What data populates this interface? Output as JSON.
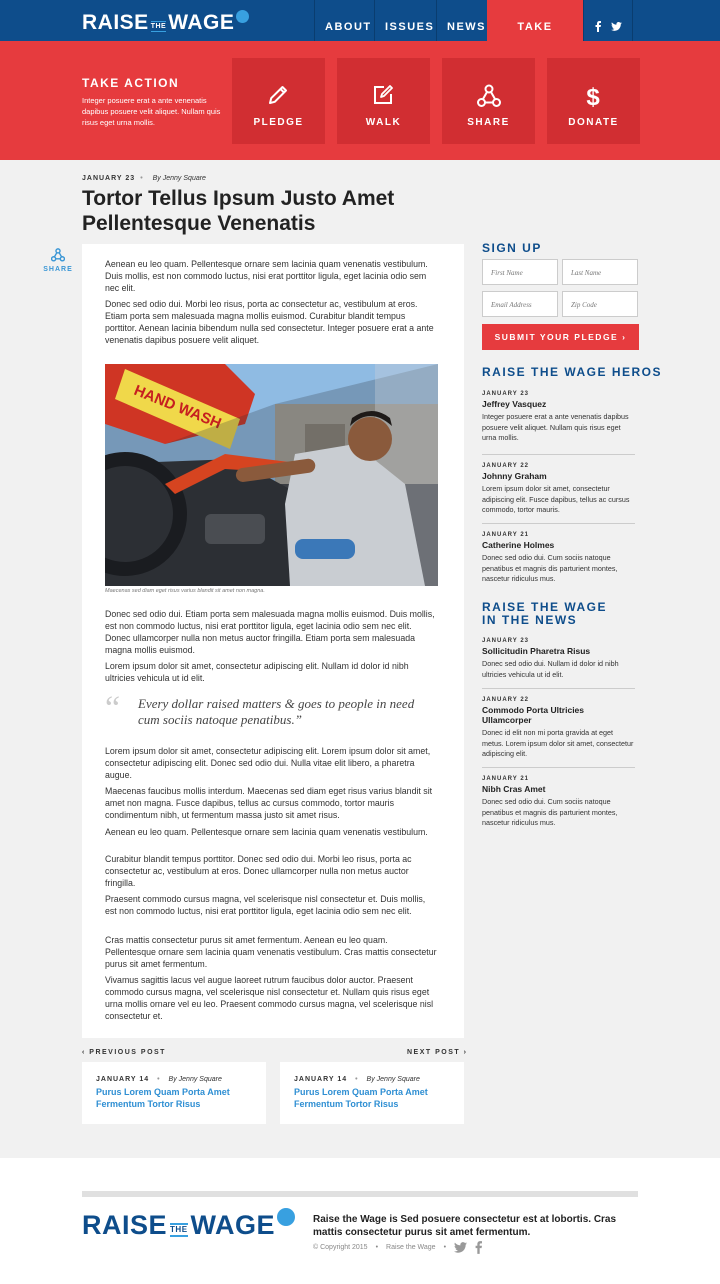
{
  "header": {
    "logo": {
      "raise": "RAISE",
      "the": "THE",
      "wage": "WAGE"
    },
    "nav": [
      "ABOUT",
      "ISSUES",
      "NEWS",
      "TAKE ACTION"
    ],
    "social": [
      "facebook-icon",
      "twitter-icon"
    ]
  },
  "action_band": {
    "title": "TAKE ACTION",
    "text": "Integer posuere erat a ante venenatis dapibus posuere velit aliquet. Nullam quis risus eget urna mollis.",
    "tiles": [
      "PLEDGE",
      "WALK",
      "SHARE",
      "DONATE"
    ]
  },
  "article": {
    "date": "JANUARY 23",
    "author": "By Jenny Square",
    "title": "Tortor Tellus Ipsum Justo Amet Pellentesque Venenatis",
    "share_label": "SHARE",
    "paragraphs_top": [
      "Aenean eu leo quam. Pellentesque ornare sem lacinia quam venenatis vestibulum. Duis mollis, est non commodo luctus, nisi erat porttitor ligula, eget lacinia odio sem nec elit.",
      "Donec sed odio dui. Morbi leo risus, porta ac consectetur ac, vestibulum at eros. Etiam porta sem malesuada magna mollis euismod. Curabitur blandit tempus porttitor. Aenean lacinia bibendum nulla sed consectetur. Integer posuere erat a ante venenatis dapibus posuere velit aliquet."
    ],
    "photo_sign": "HAND WASH",
    "caption": "Maecenas sed diam eget risus varius blandit sit amet non magna.",
    "paragraphs_mid": [
      "Donec sed odio dui. Etiam porta sem malesuada magna mollis euismod. Duis mollis, est non commodo luctus, nisi erat porttitor ligula, eget lacinia odio sem nec elit. Donec ullamcorper nulla non metus auctor fringilla. Etiam porta sem malesuada magna mollis euismod.",
      "Lorem ipsum dolor sit amet, consectetur adipiscing elit. Nullam id dolor id nibh ultricies vehicula ut id elit."
    ],
    "quote": "Every dollar raised matters & goes to people in need cum sociis natoque penatibus.”",
    "paragraphs_bottom": [
      "Lorem ipsum dolor sit amet, consectetur adipiscing elit. Lorem ipsum dolor sit amet, consectetur adipiscing elit. Donec sed odio dui. Nulla vitae elit libero, a pharetra augue.",
      "Maecenas faucibus mollis interdum. Maecenas sed diam eget risus varius blandit sit amet non magna. Fusce dapibus, tellus ac cursus commodo, tortor mauris condimentum nibh, ut fermentum massa justo sit amet risus.",
      "Aenean eu leo quam. Pellentesque ornare sem lacinia quam venenatis vestibulum.",
      "Curabitur blandit tempus porttitor. Donec sed odio dui. Morbi leo risus, porta ac consectetur ac, vestibulum at eros. Donec ullamcorper nulla non metus auctor fringilla.",
      "Praesent commodo cursus magna, vel scelerisque nisl consectetur et. Duis mollis, est non commodo luctus, nisi erat porttitor ligula, eget lacinia odio sem nec elit.",
      "Cras mattis consectetur purus sit amet fermentum. Aenean eu leo quam. Pellentesque ornare sem lacinia quam venenatis vestibulum. Cras mattis consectetur purus sit amet fermentum.",
      "Vivamus sagittis lacus vel augue laoreet rutrum faucibus dolor auctor. Praesent commodo cursus magna, vel scelerisque nisl consectetur et. Nullam quis risus eget urna mollis ornare vel eu leo. Praesent commodo cursus magna, vel scelerisque nisl consectetur et."
    ]
  },
  "pagination": {
    "prev_label": "PREVIOUS POST",
    "next_label": "NEXT POST",
    "prev": {
      "date": "JANUARY 14",
      "author": "By Jenny Square",
      "title": "Purus Lorem Quam Porta Amet Fermentum Tortor Risus"
    },
    "next": {
      "date": "JANUARY 14",
      "author": "By Jenny Square",
      "title": "Purus Lorem Quam Porta Amet Fermentum Tortor Risus"
    }
  },
  "signup": {
    "heading": "SIGN UP",
    "first_name": "First Name",
    "last_name": "Last Name",
    "email": "Email Address",
    "zip": "Zip Code",
    "button": "SUBMIT YOUR PLEDGE"
  },
  "heros": {
    "heading": "RAISE THE WAGE HEROS",
    "items": [
      {
        "date": "JANUARY 23",
        "name": "Jeffrey Vasquez",
        "text": "Integer posuere erat a ante venenatis dapibus posuere velit aliquet. Nullam quis risus eget urna mollis."
      },
      {
        "date": "JANUARY 22",
        "name": "Johnny Graham",
        "text": "Lorem ipsum dolor sit amet, consectetur adipiscing elit. Fusce dapibus, tellus ac cursus commodo, tortor mauris."
      },
      {
        "date": "JANUARY 21",
        "name": "Catherine Holmes",
        "text": "Donec sed odio dui. Cum sociis natoque penatibus et magnis dis parturient montes, nascetur ridiculus mus."
      }
    ]
  },
  "news": {
    "heading": "RAISE THE WAGE IN THE NEWS",
    "items": [
      {
        "date": "JANUARY 23",
        "name": "Sollicitudin Pharetra Risus",
        "text": "Donec sed odio dui. Nullam id dolor id nibh ultricies vehicula ut id elit."
      },
      {
        "date": "JANUARY 22",
        "name": "Commodo Porta Ultricies Ullamcorper",
        "text": "Donec id elit non mi porta gravida at eget metus. Lorem ipsum dolor sit amet, consectetur adipiscing elit."
      },
      {
        "date": "JANUARY 21",
        "name": "Nibh Cras Amet",
        "text": "Donec sed odio dui. Cum sociis natoque penatibus et magnis dis parturient montes, nascetur ridiculus mus."
      }
    ]
  },
  "footer": {
    "tagline": "Raise the Wage is Sed posuere consectetur est at lobortis. Cras mattis consectetur purus sit amet fermentum.",
    "copyright": "© Copyright 2015",
    "org": "Raise the Wage",
    "separator": "•"
  },
  "colors": {
    "navy": "#0e4d8b",
    "red": "#e63b3e",
    "dark_red": "#d12e32",
    "link_blue": "#2f8fd3"
  }
}
